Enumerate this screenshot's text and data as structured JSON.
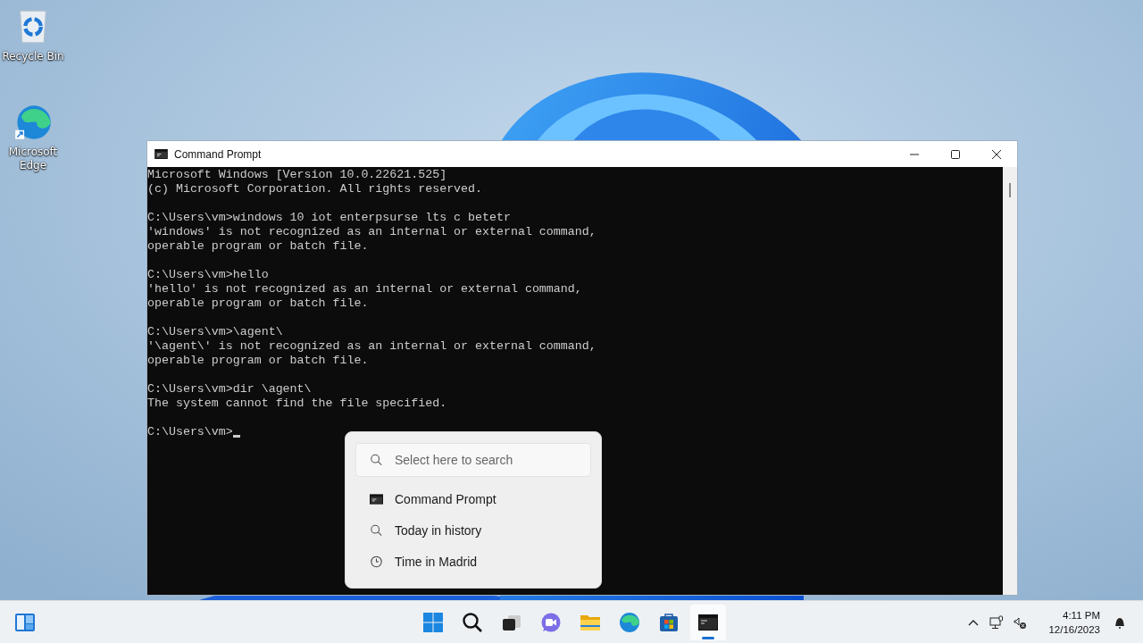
{
  "desktop_icons": [
    {
      "kind": "recycle-bin",
      "label": "Recycle Bin"
    },
    {
      "kind": "edge",
      "label": "Microsoft Edge"
    }
  ],
  "window": {
    "title": "Command Prompt",
    "console": {
      "blocks": [
        {
          "lines": [
            "Microsoft Windows [Version 10.0.22621.525]",
            "(c) Microsoft Corporation. All rights reserved."
          ]
        },
        {
          "lines": [
            "C:\\Users\\vm>windows 10 iot enterpsurse lts c betetr",
            "'windows' is not recognized as an internal or external command,",
            "operable program or batch file."
          ]
        },
        {
          "lines": [
            "C:\\Users\\vm>hello",
            "'hello' is not recognized as an internal or external command,",
            "operable program or batch file."
          ]
        },
        {
          "lines": [
            "C:\\Users\\vm>\\agent\\",
            "'\\agent\\' is not recognized as an internal or external command,",
            "operable program or batch file."
          ]
        },
        {
          "lines": [
            "C:\\Users\\vm>dir \\agent\\",
            "The system cannot find the file specified."
          ]
        }
      ],
      "prompt": "C:\\Users\\vm>"
    }
  },
  "search_popup": {
    "placeholder": "Select here to search",
    "items": [
      {
        "kind": "app",
        "label": "Command Prompt"
      },
      {
        "kind": "search",
        "label": "Today in history"
      },
      {
        "kind": "clock",
        "label": "Time in Madrid"
      }
    ]
  },
  "taskbar": {
    "apps": [
      {
        "kind": "start",
        "active": false
      },
      {
        "kind": "search",
        "active": false
      },
      {
        "kind": "task-view",
        "active": false
      },
      {
        "kind": "chat",
        "active": false
      },
      {
        "kind": "explorer",
        "active": false
      },
      {
        "kind": "edge",
        "active": false
      },
      {
        "kind": "store",
        "active": false
      },
      {
        "kind": "terminal",
        "active": true
      }
    ],
    "time": "4:11 PM",
    "date": "12/16/2023"
  }
}
